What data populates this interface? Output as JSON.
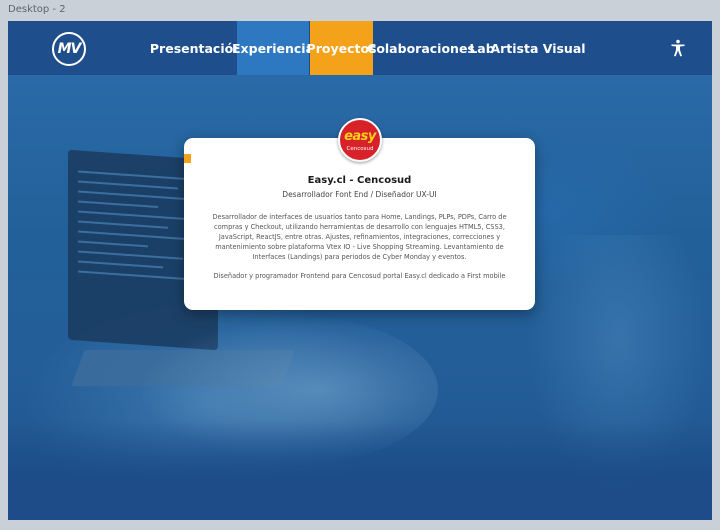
{
  "canvas_label": "Desktop - 2",
  "logo": {
    "text": "MV"
  },
  "nav": {
    "items": [
      {
        "label": "Presentación"
      },
      {
        "label": "Experiencia"
      },
      {
        "label": "Proyectos"
      },
      {
        "label": "Colaboraciones"
      },
      {
        "label": "Lab"
      },
      {
        "label": "Artista Visual"
      }
    ],
    "accessibility_icon": "accessibility-icon"
  },
  "card": {
    "badge_word": "easy",
    "badge_sub": "Cencosud",
    "title": "Easy.cl - Cencosud",
    "subtitle": "Desarrollador Font End / Diseñador UX-UI",
    "description": "Desarrollador de interfaces de usuarios tanto para Home, Landings, PLPs, PDPs, Carro de compras y Checkout, utilizando herramientas de desarrollo con lenguajes HTML5, CSS3, JavaScript, ReactJS, entre otras. Ajustes, refinamientos, integraciones, correcciones y mantenimiento sobre plataforma Vtex IO - Live Shopping Streaming. Levantamiento de Interfaces (Landings) para periodos de Cyber Monday y eventos.",
    "description2": "Diseñador y programador Frontend para Cencosud portal Easy.cl dedicado a First mobile"
  },
  "colors": {
    "nav_bg": "#1e4e8c",
    "experiencia_bg": "#2e78c2",
    "proyectos_bg": "#f5a21b",
    "badge_red": "#d8222a",
    "badge_yellow": "#f7d117"
  }
}
